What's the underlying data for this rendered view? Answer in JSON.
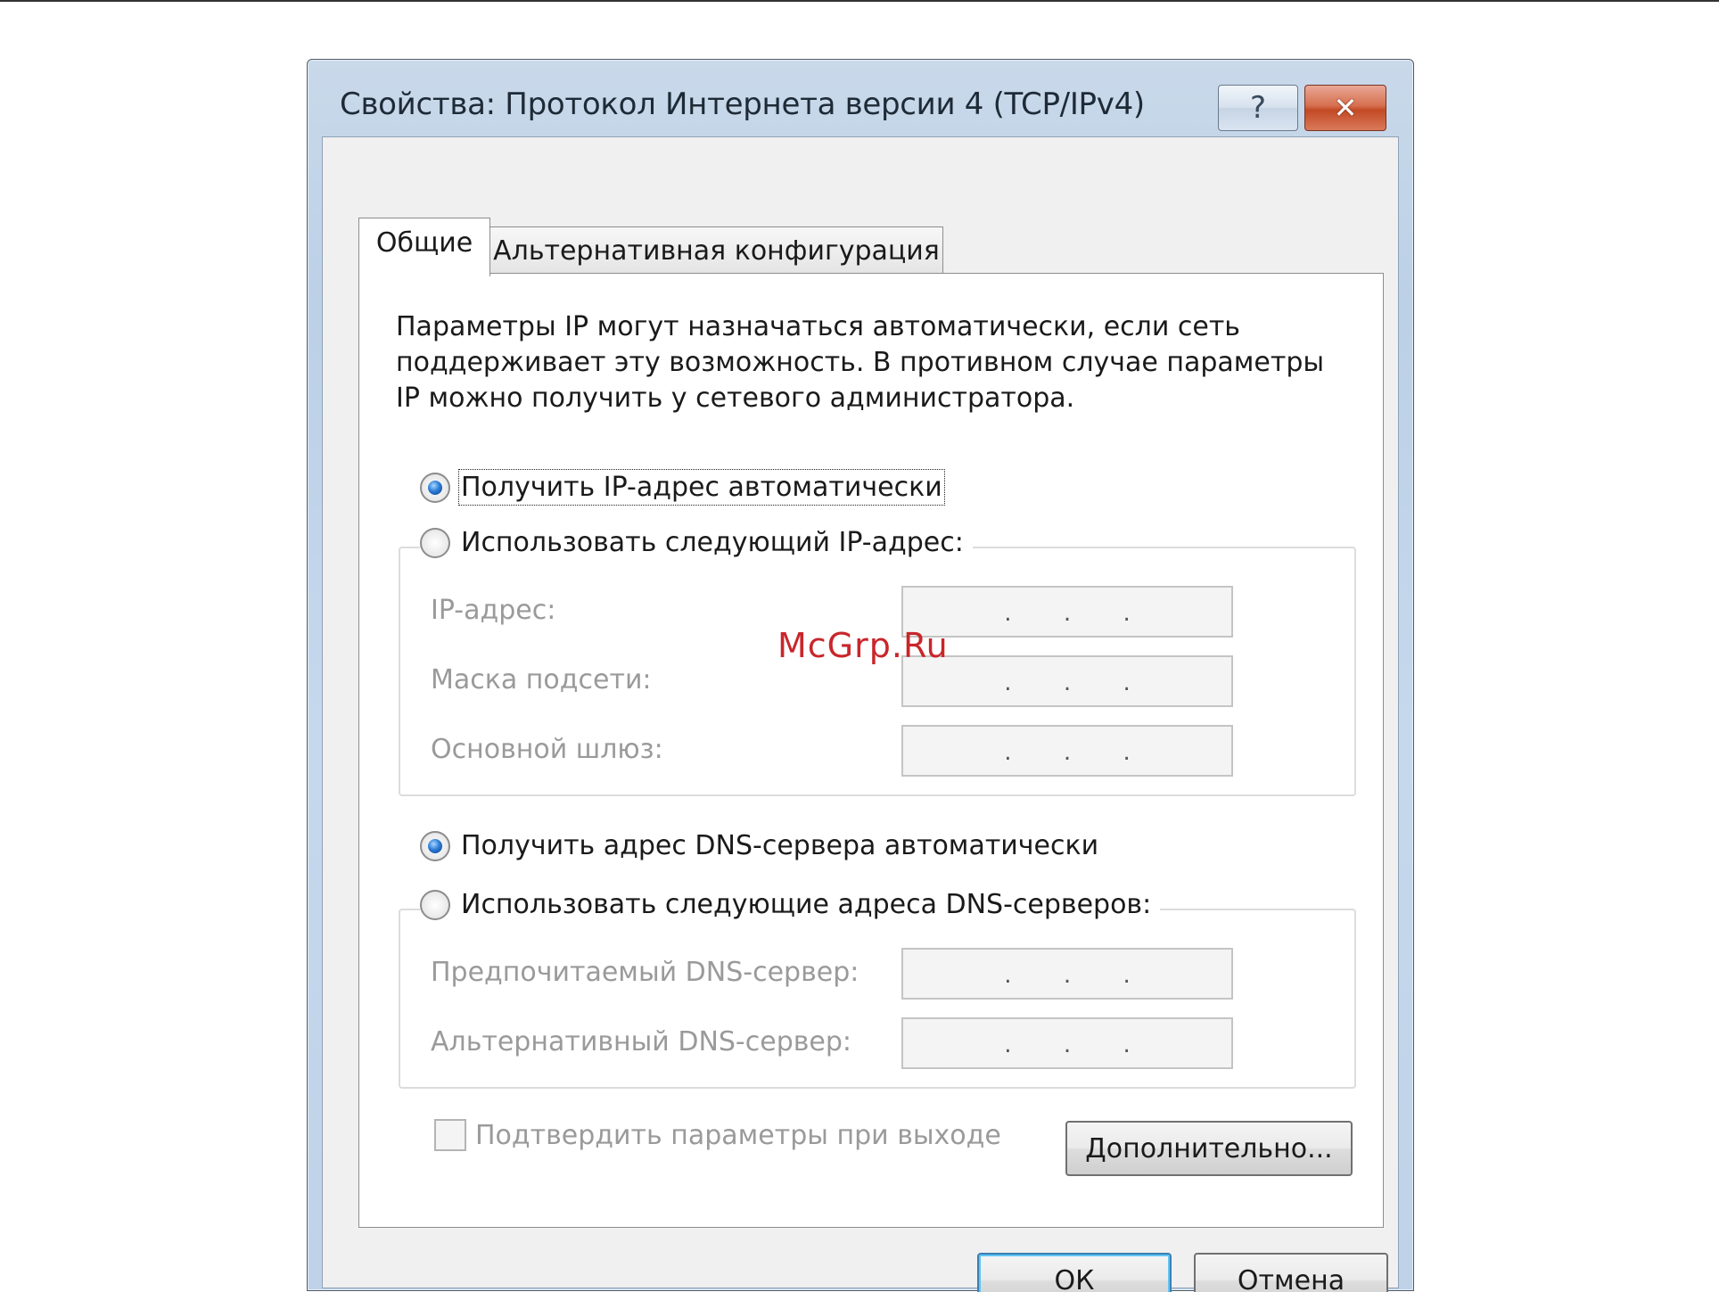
{
  "window": {
    "title": "Свойства: Протокол Интернета версии 4 (TCP/IPv4)",
    "help_glyph": "?",
    "close_glyph": "✕"
  },
  "tabs": [
    {
      "label": "Общие",
      "active": true
    },
    {
      "label": "Альтернативная конфигурация",
      "active": false
    }
  ],
  "general": {
    "description": "Параметры IP могут назначаться автоматически, если сеть поддерживает эту возможность. В противном случае параметры IP можно получить у сетевого администратора.",
    "ip_auto": {
      "label": "Получить IP-адрес автоматически",
      "checked": true
    },
    "ip_manual": {
      "label": "Использовать следующий IP-адрес:",
      "checked": false
    },
    "ip_fields": [
      {
        "label": "IP-адрес:",
        "value": ". . ."
      },
      {
        "label": "Маска подсети:",
        "value": ". . ."
      },
      {
        "label": "Основной шлюз:",
        "value": ". . ."
      }
    ],
    "dns_auto": {
      "label": "Получить адрес DNS-сервера автоматически",
      "checked": true
    },
    "dns_manual": {
      "label": "Использовать следующие адреса DNS-серверов:",
      "checked": false
    },
    "dns_fields": [
      {
        "label": "Предпочитаемый DNS-сервер:",
        "value": ". . ."
      },
      {
        "label": "Альтернативный DNS-сервер:",
        "value": ". . ."
      }
    ],
    "validate": {
      "label": "Подтвердить параметры при выходе",
      "checked": false
    },
    "advanced_button": "Дополнительно..."
  },
  "footer": {
    "ok_button": "ОК",
    "cancel_button": "Отмена"
  },
  "watermark": "McGrp.Ru"
}
